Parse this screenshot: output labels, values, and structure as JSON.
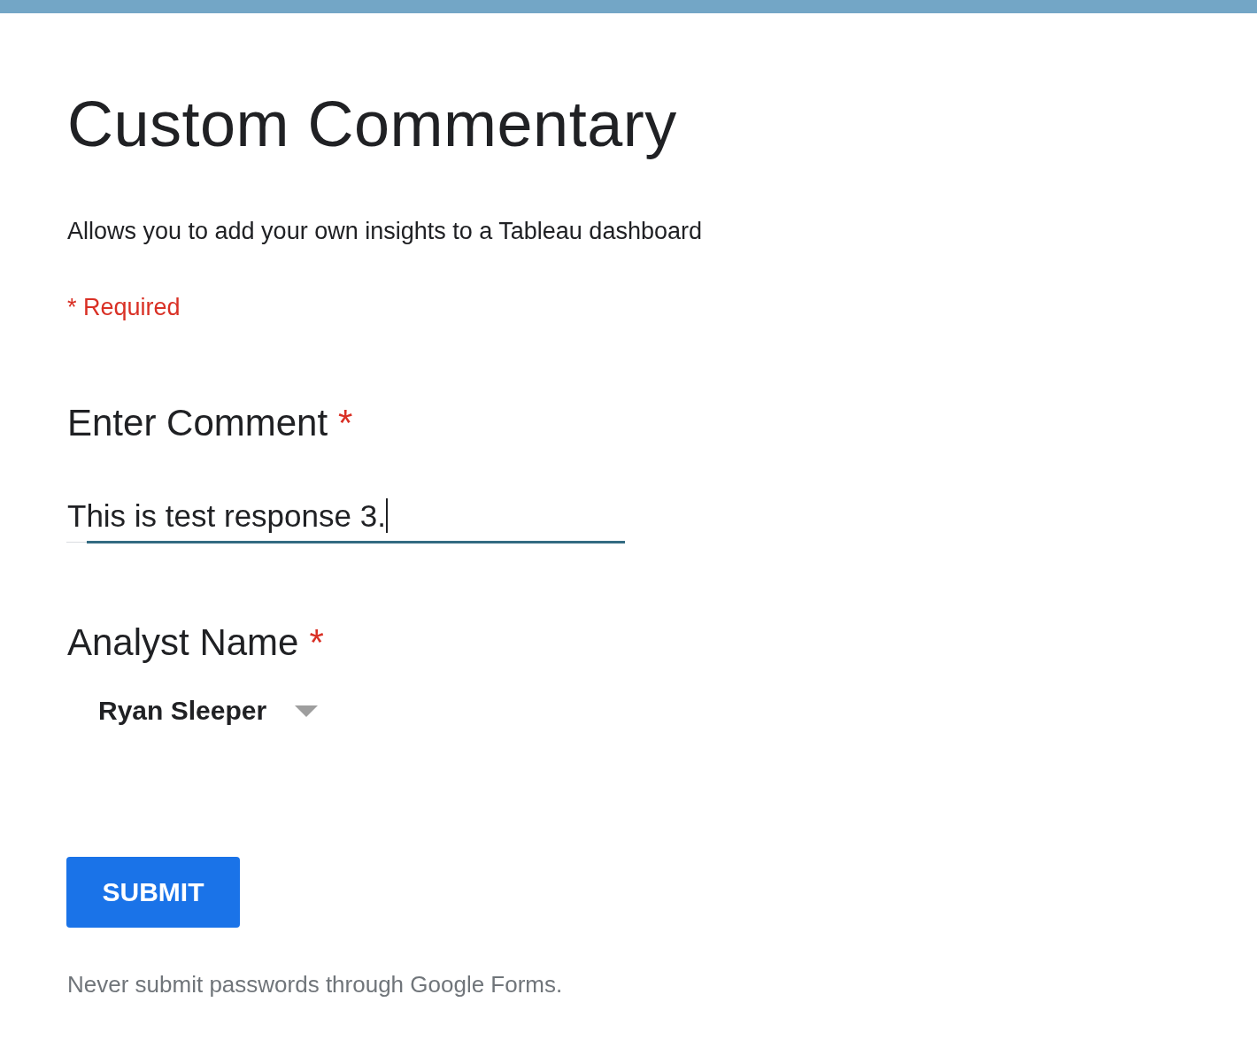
{
  "form": {
    "title": "Custom Commentary",
    "description": "Allows you to add your own insights to a Tableau dashboard",
    "required_note": "* Required"
  },
  "questions": [
    {
      "kind": "text",
      "label": "Enter Comment",
      "required_mark": "*",
      "value": "This is test response 3.",
      "focused": true
    },
    {
      "kind": "dropdown",
      "label": "Analyst Name",
      "required_mark": "*",
      "value": "Ryan Sleeper"
    }
  ],
  "submit": {
    "label": "SUBMIT"
  },
  "footer": "Never submit passwords through Google Forms."
}
